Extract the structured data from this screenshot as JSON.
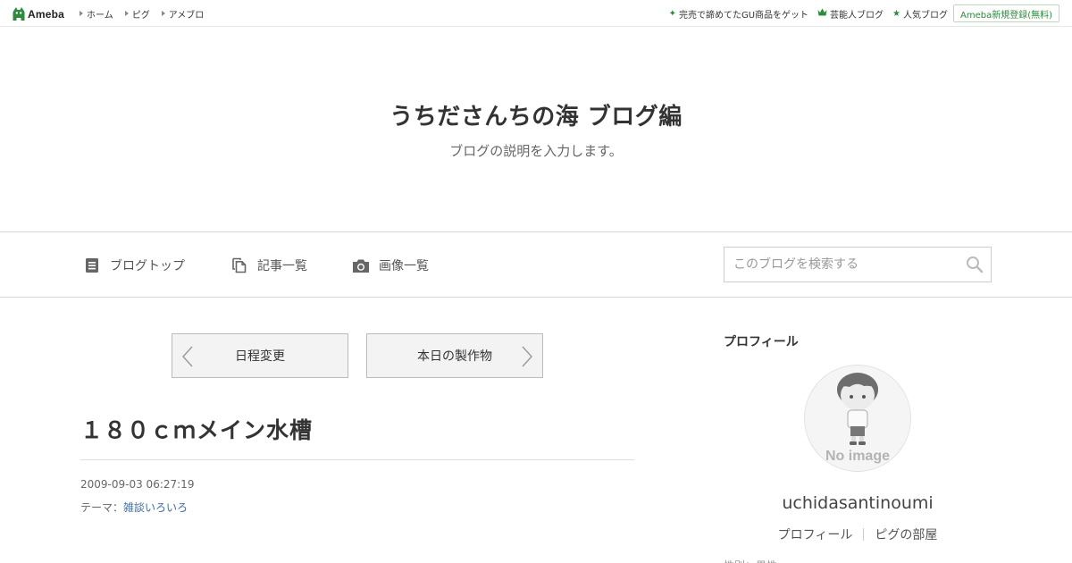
{
  "topbar": {
    "logo_text": "Ameba",
    "logo_icon": "ameba-mascot-icon",
    "nav": [
      {
        "label": "ホーム"
      },
      {
        "label": "ピグ"
      },
      {
        "label": "アメブロ"
      }
    ],
    "links": [
      {
        "icon": "sparkle-icon",
        "label": "完売で諦めてたGU商品をゲット"
      },
      {
        "icon": "crown-icon",
        "label": "芸能人ブログ"
      },
      {
        "icon": "star-icon",
        "label": "人気ブログ"
      }
    ],
    "register_label": "Ameba新規登録(無料)",
    "accent_color": "#2d8a3e"
  },
  "header": {
    "title": "うちださんちの海 ブログ編",
    "description": "ブログの説明を入力します。"
  },
  "nav": {
    "items": [
      {
        "icon": "document-icon",
        "label": "ブログトップ"
      },
      {
        "icon": "copy-icon",
        "label": "記事一覧"
      },
      {
        "icon": "camera-icon",
        "label": "画像一覧"
      }
    ],
    "search": {
      "placeholder": "このブログを検索する",
      "icon": "search-icon"
    }
  },
  "entry": {
    "prev_label": "日程変更",
    "next_label": "本日の製作物",
    "title": "１８０ｃｍメイン水槽",
    "date": "2009-09-03 06:27:19",
    "theme_prefix": "テーマ：",
    "theme_label": "雑談いろいろ",
    "link_color": "#3d6ea8"
  },
  "sidebar": {
    "profile_heading": "プロフィール",
    "avatar_text": "No image",
    "username": "uchidasantinoumi",
    "links": [
      {
        "label": "プロフィール"
      },
      {
        "label": "ピグの部屋"
      }
    ],
    "cutoff_text": "性別：男性"
  }
}
